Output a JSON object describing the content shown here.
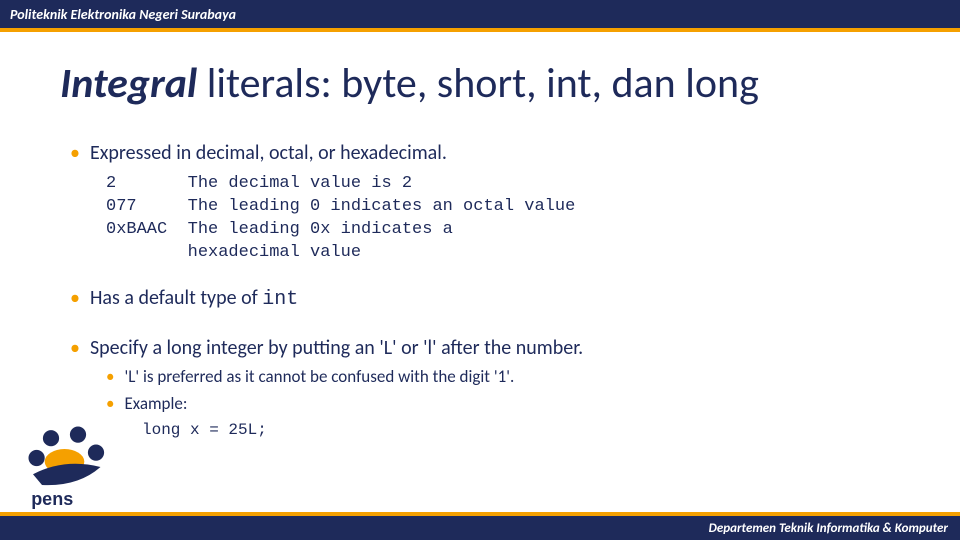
{
  "header": {
    "institution": "Politeknik Elektronika Negeri Surabaya"
  },
  "footer": {
    "department": "Departemen Teknik Informatika & Komputer"
  },
  "logo": {
    "text": "pens"
  },
  "title": {
    "emph": "Integral",
    "rest": " literals: byte, short, int, dan long"
  },
  "body": {
    "b1": "Expressed in decimal, octal, or hexadecimal.",
    "code1": "2       The decimal value is 2\n077     The leading 0 indicates an octal value\n0xBAAC  The leading 0x indicates a\n        hexadecimal value",
    "b2_pre": "Has a default type of ",
    "b2_code": "int",
    "b3": "Specify a long integer by putting an 'L' or 'l' after the number.",
    "b3a": "'L' is preferred as it cannot be confused with the digit '1'.",
    "b3b": "Example:",
    "code2": "long x = 25L;"
  }
}
